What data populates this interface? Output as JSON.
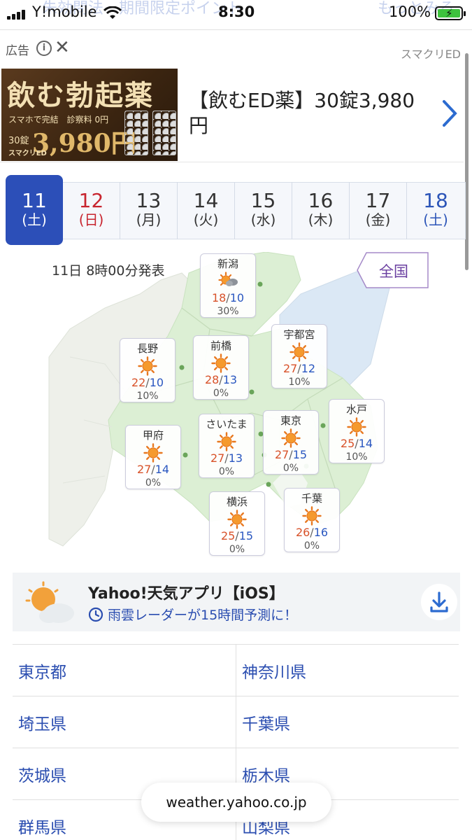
{
  "status_bar": {
    "carrier": "Y!mobile",
    "time": "8:30",
    "battery": "100%",
    "ghost_left": "朱効問法　期間限定ポイント",
    "ghost_right": "もっとみる"
  },
  "ad": {
    "label": "広告",
    "sponsor": "スマクリED",
    "image_title": "飲む勃起薬",
    "image_sub": "スマホで完結　診察料 0円",
    "image_count": "30錠",
    "image_price": "3,980円",
    "image_brand": "スマクリED",
    "text": "【飲むED薬】30錠3,980円"
  },
  "date_tabs": [
    {
      "day": "11",
      "weekday": "(土)",
      "state": "selected"
    },
    {
      "day": "12",
      "weekday": "(日)",
      "state": "sunday"
    },
    {
      "day": "13",
      "weekday": "(月)",
      "state": "weekday"
    },
    {
      "day": "14",
      "weekday": "(火)",
      "state": "weekday"
    },
    {
      "day": "15",
      "weekday": "(水)",
      "state": "weekday"
    },
    {
      "day": "16",
      "weekday": "(木)",
      "state": "weekday"
    },
    {
      "day": "17",
      "weekday": "(金)",
      "state": "weekday"
    },
    {
      "day": "18",
      "weekday": "(土)",
      "state": "saturday"
    }
  ],
  "map": {
    "issued": "11日 8時00分発表",
    "nationwide_button": "全国",
    "cities": [
      {
        "name": "新潟",
        "high": "18",
        "low": "10",
        "pop": "30%",
        "icon": "sun-cloud-icon"
      },
      {
        "name": "長野",
        "high": "22",
        "low": "10",
        "pop": "10%",
        "icon": "sun-icon"
      },
      {
        "name": "前橋",
        "high": "28",
        "low": "13",
        "pop": "0%",
        "icon": "sun-icon"
      },
      {
        "name": "宇都宮",
        "high": "27",
        "low": "12",
        "pop": "10%",
        "icon": "sun-icon"
      },
      {
        "name": "水戸",
        "high": "25",
        "low": "14",
        "pop": "10%",
        "icon": "sun-icon"
      },
      {
        "name": "甲府",
        "high": "27",
        "low": "14",
        "pop": "0%",
        "icon": "sun-icon"
      },
      {
        "name": "さいたま",
        "high": "27",
        "low": "13",
        "pop": "0%",
        "icon": "sun-icon"
      },
      {
        "name": "東京",
        "high": "27",
        "low": "15",
        "pop": "0%",
        "icon": "sun-icon"
      },
      {
        "name": "横浜",
        "high": "25",
        "low": "15",
        "pop": "0%",
        "icon": "sun-icon"
      },
      {
        "name": "千葉",
        "high": "26",
        "low": "16",
        "pop": "0%",
        "icon": "sun-icon"
      }
    ]
  },
  "app_banner": {
    "title": "Yahoo!天気アプリ【iOS】",
    "subtitle": "雨雲レーダーが15時間予測に！"
  },
  "prefectures": [
    "東京都",
    "神奈川県",
    "埼玉県",
    "千葉県",
    "茨城県",
    "栃木県",
    "群馬県",
    "山梨県"
  ],
  "url_bar": {
    "url": "weather.yahoo.co.jp"
  },
  "colors": {
    "accent": "#2c4fb8",
    "high_temp": "#d8522a",
    "low_temp": "#2a57c0",
    "sunday": "#c8252f",
    "saturday": "#2c55b8",
    "link": "#2a4db0"
  }
}
